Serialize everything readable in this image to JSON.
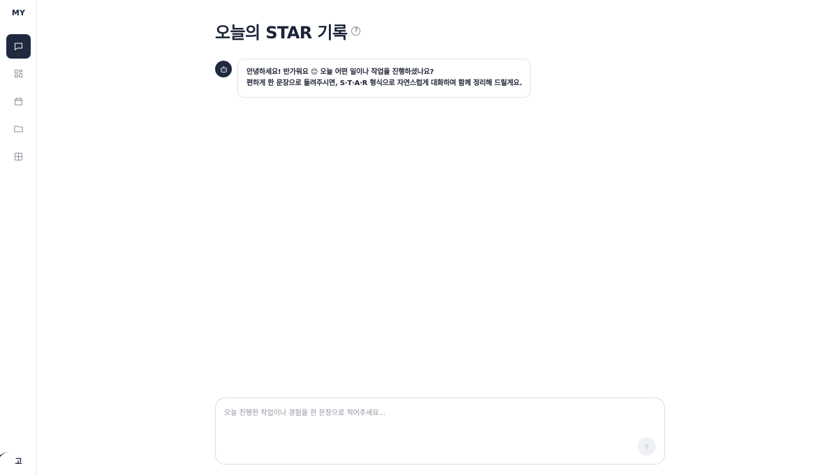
{
  "sidebar": {
    "brand": "MY",
    "nav": [
      {
        "name": "chat",
        "icon": "chat-bubble-icon",
        "active": true
      },
      {
        "name": "dashboard",
        "icon": "dashboard-grid-icon",
        "active": false
      },
      {
        "name": "calendar",
        "icon": "calendar-icon",
        "active": false
      },
      {
        "name": "folder",
        "icon": "folder-icon",
        "active": false
      },
      {
        "name": "table",
        "icon": "table-grid-icon",
        "active": false
      }
    ],
    "user_initial": "고"
  },
  "main": {
    "title": "오늘의 STAR 기록",
    "help_glyph": "?",
    "messages": [
      {
        "role": "bot",
        "lines": [
          "안녕하세요! 반가워요 😊 오늘 어떤 일이나 작업을 진행하셨나요?",
          "편하게 한 문장으로 들려주시면, S·T·A·R 형식으로 자연스럽게 대화하며 함께 정리해 드릴게요."
        ]
      }
    ]
  },
  "composer": {
    "placeholder": "오늘 진행한 작업이나 경험을 한 문장으로 적어주세요...",
    "value": ""
  },
  "colors": {
    "accent_dark": "#1f2a40",
    "border": "#e2e5ea",
    "muted_icon": "#8a909c"
  }
}
